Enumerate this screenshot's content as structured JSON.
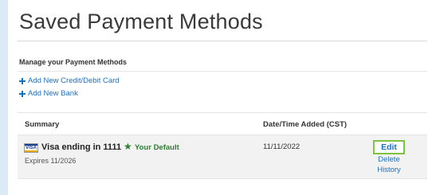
{
  "page": {
    "title": "Saved Payment Methods",
    "section_label": "Manage your Payment Methods"
  },
  "actions": {
    "add_card": "Add New Credit/Debit Card",
    "add_bank": "Add New Bank"
  },
  "table": {
    "columns": [
      "Summary",
      "Date/Time Added (CST)"
    ],
    "rows": [
      {
        "card_icon": "visa-card-icon",
        "name": "Visa ending in 1111",
        "default_icon": "star-icon",
        "default_label": "Your Default",
        "expires": "Expires 11/2026",
        "date_added": "11/11/2022",
        "edit": "Edit",
        "delete": "Delete",
        "history": "History"
      }
    ]
  },
  "colors": {
    "link": "#1f6fb5",
    "default_green": "#2e7d32",
    "edit_border": "#7fc241",
    "page_background": "#dceaf5"
  }
}
